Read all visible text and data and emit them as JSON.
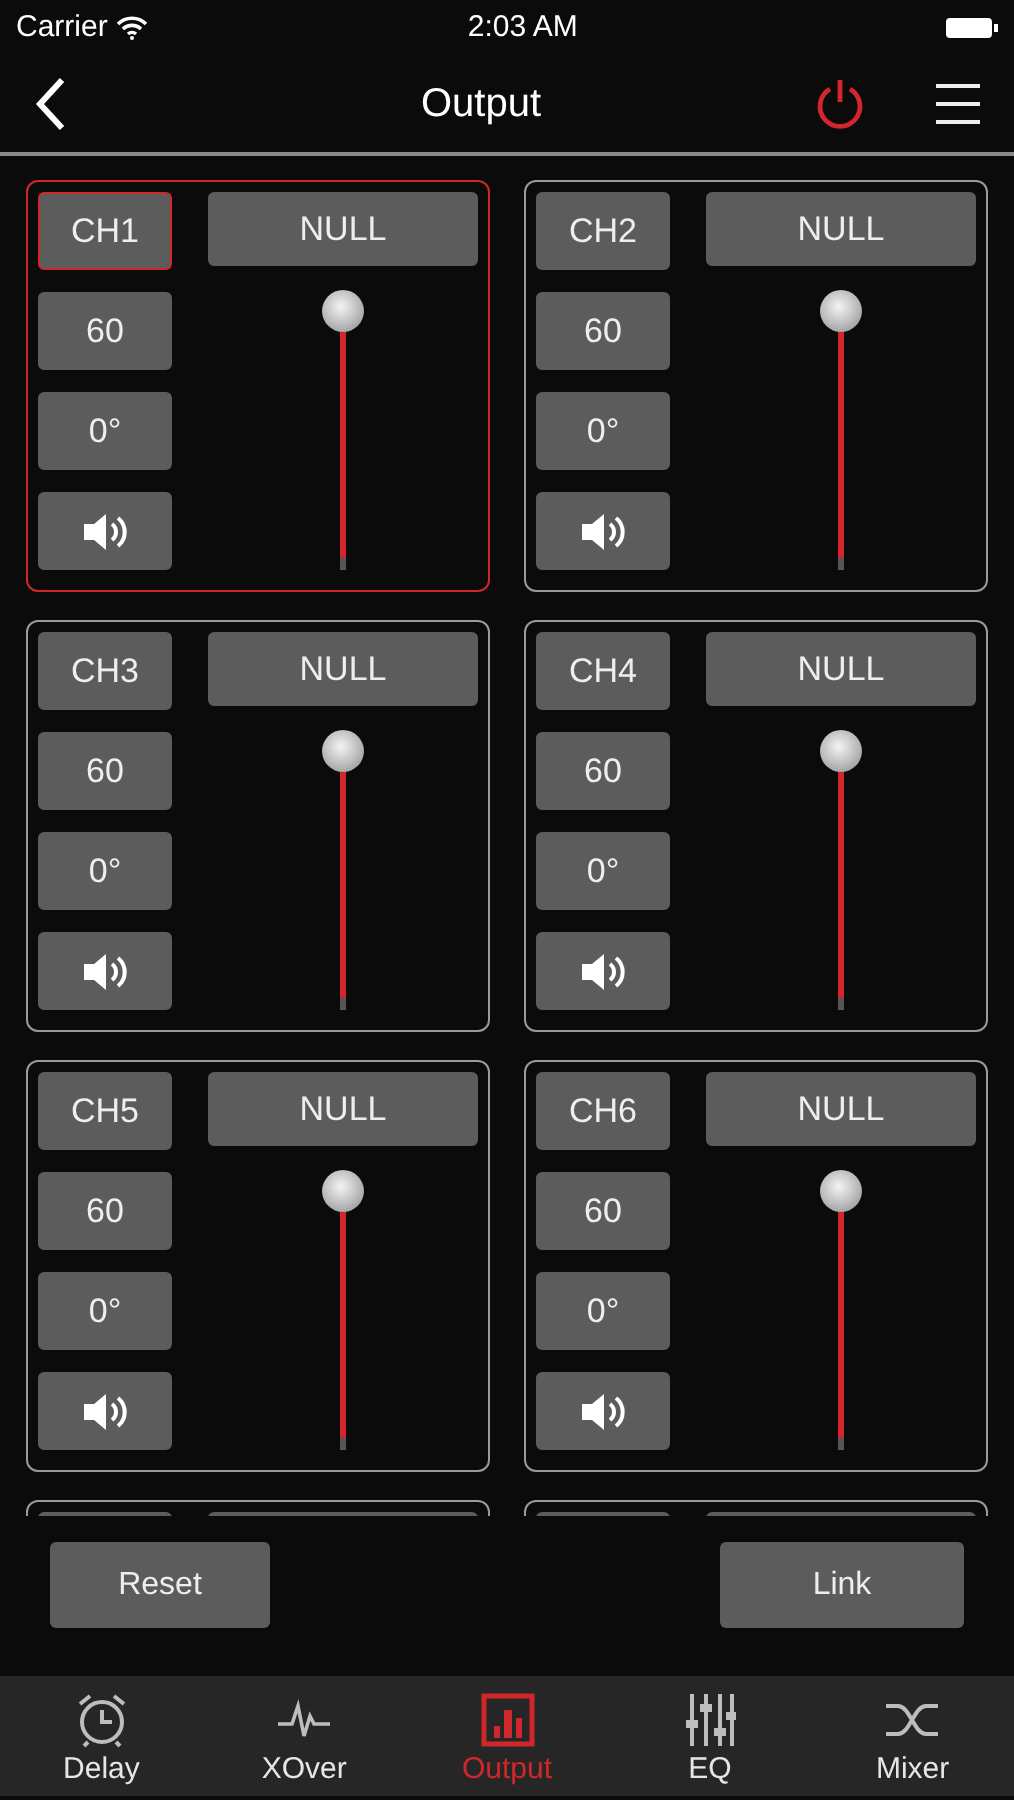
{
  "status_bar": {
    "carrier": "Carrier",
    "time": "2:03 AM"
  },
  "nav": {
    "title": "Output"
  },
  "channels": [
    {
      "name": "CH1",
      "preset": "NULL",
      "value": "60",
      "phase": "0°",
      "muted": false,
      "level": 1,
      "selected": true
    },
    {
      "name": "CH2",
      "preset": "NULL",
      "value": "60",
      "phase": "0°",
      "muted": false,
      "level": 1,
      "selected": false
    },
    {
      "name": "CH3",
      "preset": "NULL",
      "value": "60",
      "phase": "0°",
      "muted": false,
      "level": 1,
      "selected": false
    },
    {
      "name": "CH4",
      "preset": "NULL",
      "value": "60",
      "phase": "0°",
      "muted": false,
      "level": 1,
      "selected": false
    },
    {
      "name": "CH5",
      "preset": "NULL",
      "value": "60",
      "phase": "0°",
      "muted": false,
      "level": 1,
      "selected": false
    },
    {
      "name": "CH6",
      "preset": "NULL",
      "value": "60",
      "phase": "0°",
      "muted": false,
      "level": 1,
      "selected": false
    }
  ],
  "more_channels_below": true,
  "actions": [
    "Reset",
    "Link"
  ],
  "tabs": [
    {
      "label": "Delay",
      "kind": "clock",
      "selected": false
    },
    {
      "label": "XOver",
      "kind": "pulse",
      "selected": false
    },
    {
      "label": "Output",
      "kind": "bars",
      "selected": true
    },
    {
      "label": "EQ",
      "kind": "sliders",
      "selected": false
    },
    {
      "label": "Mixer",
      "kind": "cross",
      "selected": false
    }
  ]
}
